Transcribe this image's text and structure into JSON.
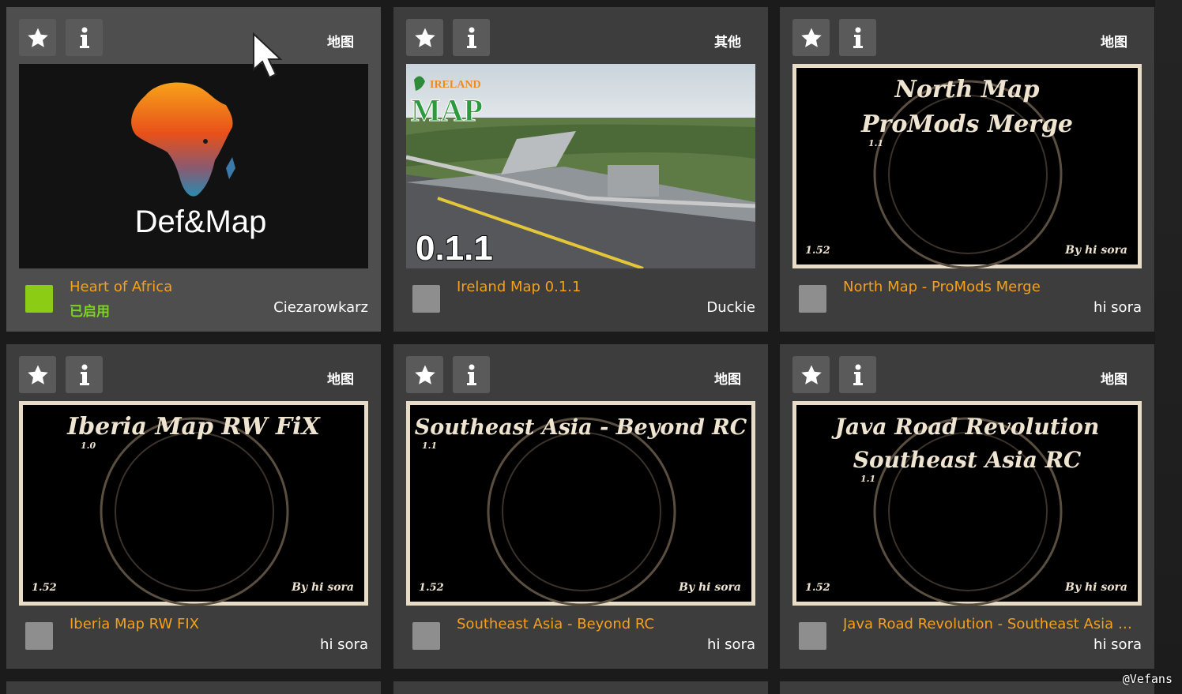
{
  "mods": [
    {
      "id": "heart-of-africa",
      "category": "地图",
      "title": "Heart of Africa",
      "status": "已启用",
      "author": "Ciezarowkarz",
      "enabled": true,
      "thumb_text": "Def&Map"
    },
    {
      "id": "ireland-map",
      "category": "其他",
      "title": "Ireland Map 0.1.1",
      "status": "",
      "author": "Duckie",
      "enabled": false,
      "thumb_logo_top": "IRELAND",
      "thumb_logo_main": "MAP",
      "thumb_version": "0.1.1"
    },
    {
      "id": "north-map",
      "category": "地图",
      "title": "North Map - ProMods Merge",
      "status": "",
      "author": "hi sora",
      "enabled": false,
      "thumb_line1": "North Map",
      "thumb_line2": "ProMods Merge",
      "thumb_ver": "1.1",
      "thumb_game_ver": "1.52",
      "thumb_by": "By hi sora"
    },
    {
      "id": "iberia-map",
      "category": "地图",
      "title": "Iberia Map RW FIX",
      "status": "",
      "author": "hi sora",
      "enabled": false,
      "thumb_line1": "Iberia Map RW FiX",
      "thumb_line2": "",
      "thumb_ver": "1.0",
      "thumb_game_ver": "1.52",
      "thumb_by": "By hi sora"
    },
    {
      "id": "southeast-asia",
      "category": "地图",
      "title": "Southeast Asia - Beyond RC",
      "status": "",
      "author": "hi sora",
      "enabled": false,
      "thumb_line1": "Southeast Asia - Beyond RC",
      "thumb_line2": "",
      "thumb_ver": "1.1",
      "thumb_game_ver": "1.52",
      "thumb_by": "By hi sora"
    },
    {
      "id": "java-road",
      "category": "地图",
      "title": "Java Road Revolution - Southeast Asia M..",
      "status": "",
      "author": "hi sora",
      "enabled": false,
      "thumb_line1": "Java Road Revolution",
      "thumb_line2": "Southeast Asia RC",
      "thumb_ver": "1.1",
      "thumb_game_ver": "1.52",
      "thumb_by": "By hi sora"
    }
  ],
  "icons": {
    "favorite": "star-icon",
    "info": "info-icon",
    "cursor": "mouse-pointer-icon"
  },
  "colors": {
    "title": "#f6a01a",
    "enabled_text": "#7dd321",
    "enabled_checkbox": "#8ccc14",
    "checkbox": "#8e8e8e",
    "card": "#3d3d3d",
    "card_active": "#4e4e4e",
    "button": "#5a5a5a"
  },
  "watermark": "@Vefans"
}
